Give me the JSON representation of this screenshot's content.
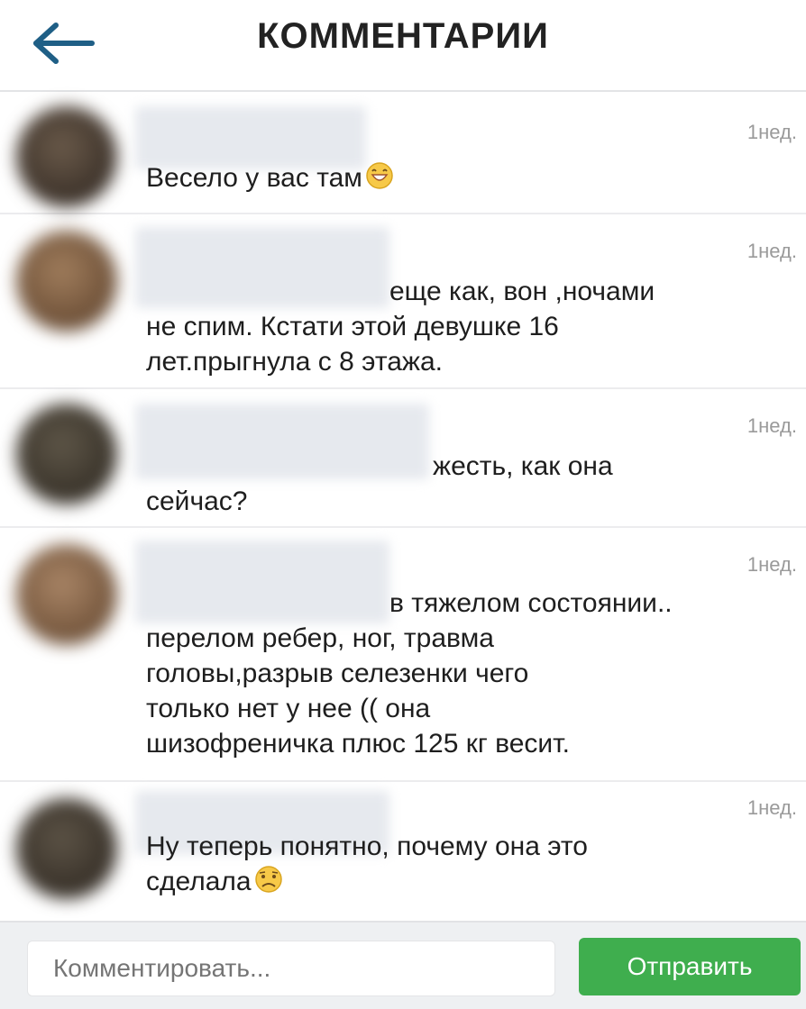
{
  "header": {
    "back_icon": "arrow-left-icon",
    "title": "КОММЕНТАРИИ"
  },
  "comments": [
    {
      "time": "1нед.",
      "lines": [
        "Весело у вас там"
      ],
      "emoji": "grinning-face-icon"
    },
    {
      "time": "1нед.",
      "lines": [
        "еще как, вон ,ночами",
        "не спим. Кстати этой девушке 16",
        "лет.прыгнула с 8 этажа."
      ]
    },
    {
      "time": "1нед.",
      "lines": [
        "жесть, как она",
        "сейчас?"
      ]
    },
    {
      "time": "1нед.",
      "lines": [
        "в тяжелом состоянии..",
        "перелом ребер, ног, травма",
        "головы,разрыв селезенки чего",
        "только нет у нее (( она",
        "шизофреничка плюс 125 кг весит."
      ]
    },
    {
      "time": "1нед.",
      "lines": [
        "Ну теперь понятно, почему она это",
        "сделала"
      ],
      "emoji": "worried-face-icon"
    }
  ],
  "footer": {
    "input_placeholder": "Комментировать...",
    "send_label": "Отправить"
  },
  "colors": {
    "send_button": "#3fae4e",
    "back_arrow": "#1f5f86"
  }
}
